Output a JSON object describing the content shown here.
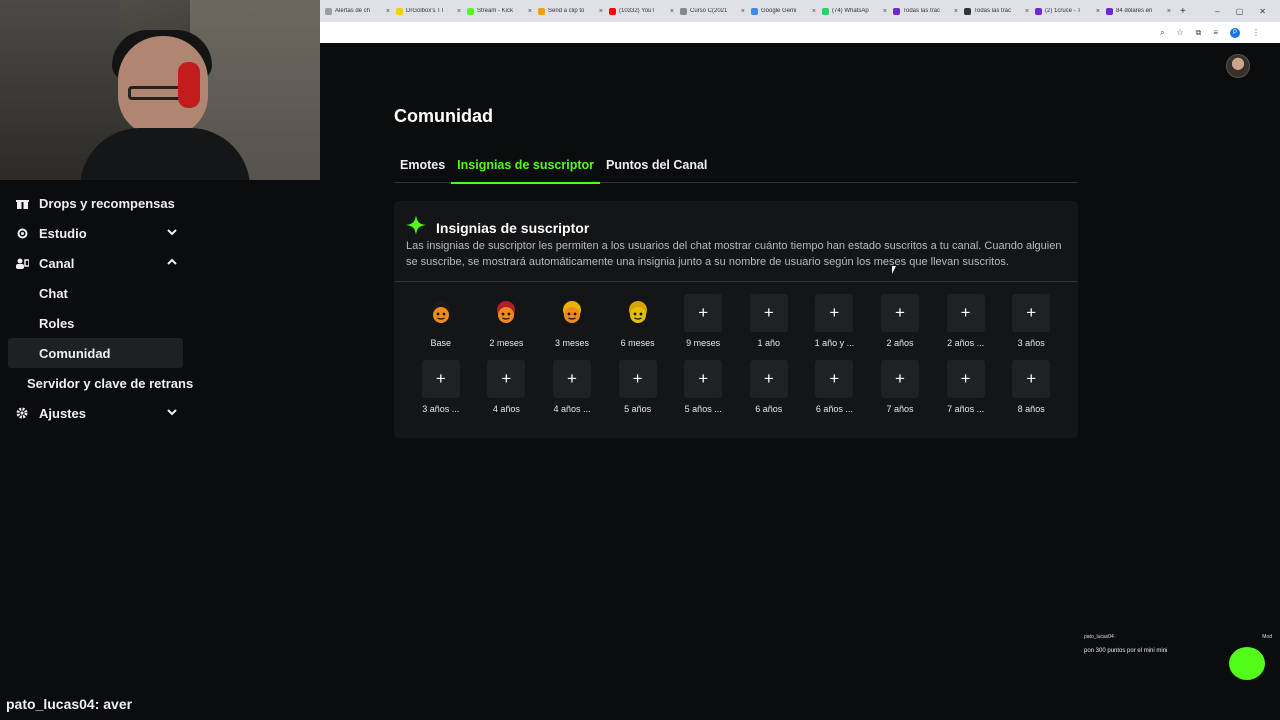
{
  "browser": {
    "tabs": [
      {
        "label": "Alertas de ch",
        "color": "#9e9e9e"
      },
      {
        "label": "DrGolbox's TT",
        "color": "#f5d000"
      },
      {
        "label": "Stream - Kick",
        "color": "#53fc18"
      },
      {
        "label": "Send a clip to",
        "color": "#f59e0b"
      },
      {
        "label": "(10332) YouT",
        "color": "#ff0000"
      },
      {
        "label": "Curso C(2021",
        "color": "#888888"
      },
      {
        "label": "Google Gemi",
        "color": "#4285f4"
      },
      {
        "label": "(74) WhatsAp",
        "color": "#25d366"
      },
      {
        "label": "Todas las trac",
        "color": "#6d28d9"
      },
      {
        "label": "Todas las trac",
        "color": "#333333"
      },
      {
        "label": "(2) 1cruce - T",
        "color": "#6d28d9"
      },
      {
        "label": "84 dólares en",
        "color": "#6d28d9"
      }
    ],
    "close_glyph": "×",
    "new_tab_glyph": "+",
    "window_controls": [
      "–",
      "▢",
      "✕"
    ],
    "profile_initial": "P"
  },
  "sidebar": {
    "items": [
      {
        "label": "Drops y recompensas",
        "icon": "gift-icon"
      },
      {
        "label": "Estudio",
        "icon": "studio-icon",
        "chevron": "down"
      },
      {
        "label": "Canal",
        "icon": "channel-icon",
        "chevron": "up"
      }
    ],
    "canal_sub": [
      {
        "label": "Chat"
      },
      {
        "label": "Roles"
      },
      {
        "label": "Comunidad",
        "active": true
      }
    ],
    "stream_key": "Servidor y clave de retrans",
    "settings": {
      "label": "Ajustes",
      "icon": "gear-icon",
      "chevron": "down"
    }
  },
  "main": {
    "title": "Comunidad",
    "tabs": [
      {
        "label": "Emotes",
        "active": false
      },
      {
        "label": "Insignias de suscriptor",
        "active": true
      },
      {
        "label": "Puntos del Canal",
        "active": false
      }
    ],
    "card": {
      "title": "Insignias de suscriptor",
      "description": "Las insignias de suscriptor les permiten a los usuarios del chat mostrar cuánto tiempo han estado suscritos a tu canal. Cuando alguien se suscribe, se mostrará automáticamente una insignia junto a su nombre de usuario según los meses que llevan suscritos.",
      "badges": [
        {
          "label": "Base",
          "type": "image",
          "icon": "base-badge-icon"
        },
        {
          "label": "2 meses",
          "type": "image",
          "icon": "2-months-badge-icon"
        },
        {
          "label": "3 meses",
          "type": "image",
          "icon": "3-months-badge-icon"
        },
        {
          "label": "6 meses",
          "type": "image",
          "icon": "6-months-badge-icon"
        },
        {
          "label": "9 meses",
          "type": "add"
        },
        {
          "label": "1 año",
          "type": "add"
        },
        {
          "label": "1 año y ...",
          "type": "add"
        },
        {
          "label": "2 años",
          "type": "add"
        },
        {
          "label": "2 años ...",
          "type": "add"
        },
        {
          "label": "3 años",
          "type": "add"
        },
        {
          "label": "3 años ...",
          "type": "add"
        },
        {
          "label": "4 años",
          "type": "add"
        },
        {
          "label": "4 años ...",
          "type": "add"
        },
        {
          "label": "5 años",
          "type": "add"
        },
        {
          "label": "5 años ...",
          "type": "add"
        },
        {
          "label": "6 años",
          "type": "add"
        },
        {
          "label": "6 años ...",
          "type": "add"
        },
        {
          "label": "7 años",
          "type": "add"
        },
        {
          "label": "7 años ...",
          "type": "add"
        },
        {
          "label": "8 años",
          "type": "add"
        }
      ],
      "add_glyph": "+"
    }
  },
  "chat_overlay": {
    "username": "pato_lucas04",
    "badge_text": "Mod",
    "message": "pon 300 puntos por el mini mini"
  },
  "footer": {
    "username": "pato_lucas04:",
    "message": " aver"
  },
  "colors": {
    "accent": "#53fc18",
    "background": "#0b0c0d",
    "card": "#141517"
  }
}
